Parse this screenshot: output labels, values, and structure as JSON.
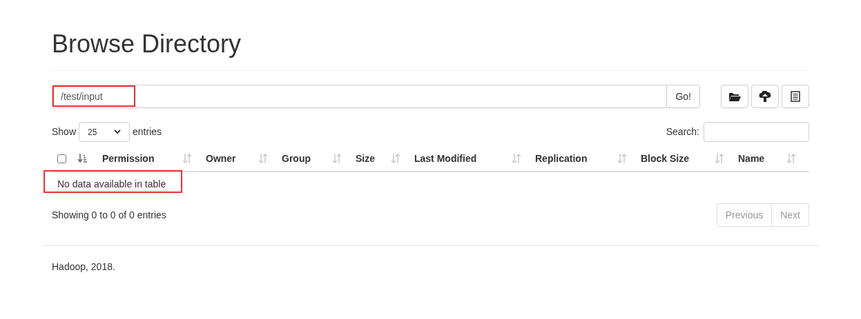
{
  "page": {
    "title": "Browse Directory"
  },
  "path_bar": {
    "value": "/test/input",
    "highlighted": true,
    "go_button": "Go!"
  },
  "toolbar_buttons": [
    {
      "kind": "folder"
    },
    {
      "kind": "upload"
    },
    {
      "kind": "list"
    }
  ],
  "length_control": {
    "show_label": "Show",
    "value": "25",
    "entries_label": "entries"
  },
  "search": {
    "label": "Search:"
  },
  "table": {
    "columns": [
      {
        "kind": "checkbox",
        "checked": false,
        "sorted": true
      },
      {
        "kind": "text",
        "label": "Permission",
        "sorted": false
      },
      {
        "kind": "text",
        "label": "Owner",
        "sorted": false
      },
      {
        "kind": "text",
        "label": "Group",
        "sorted": false
      },
      {
        "kind": "text",
        "label": "Size",
        "sorted": false
      },
      {
        "kind": "text",
        "label": "Last Modified",
        "sorted": false
      },
      {
        "kind": "text",
        "label": "Replication",
        "sorted": false
      },
      {
        "kind": "text",
        "label": "Block Size",
        "sorted": false
      },
      {
        "kind": "text",
        "label": "Name",
        "sorted": false
      }
    ],
    "empty_message": "No data available in table",
    "empty_highlighted": true
  },
  "info": "Showing 0 to 0 of 0 entries",
  "pagination": [
    {
      "label": "Previous",
      "disabled": true
    },
    {
      "label": "Next",
      "disabled": true
    }
  ],
  "footer": "Hadoop, 2018."
}
